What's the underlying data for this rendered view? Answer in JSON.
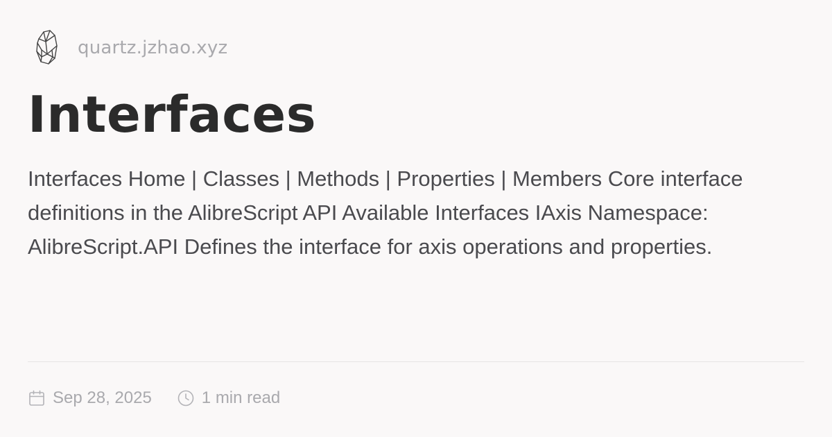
{
  "site": {
    "logo_icon": "quartz-crystal-icon",
    "name": "quartz.jzhao.xyz"
  },
  "page": {
    "title": "Interfaces",
    "description": "Interfaces Home | Classes | Methods | Properties | Members Core interface definitions in the AlibreScript API Available Interfaces IAxis Namespace: AlibreScript.API Defines the interface for axis operations and properties."
  },
  "meta": {
    "date_icon": "calendar-icon",
    "date": "Sep 28, 2025",
    "read_icon": "clock-icon",
    "read_time": "1 min read"
  },
  "colors": {
    "background": "#faf8f8",
    "title": "#2b2b2b",
    "body_text": "#4a4a4e",
    "muted": "#a9a9ad",
    "divider": "#e6e4e4"
  }
}
